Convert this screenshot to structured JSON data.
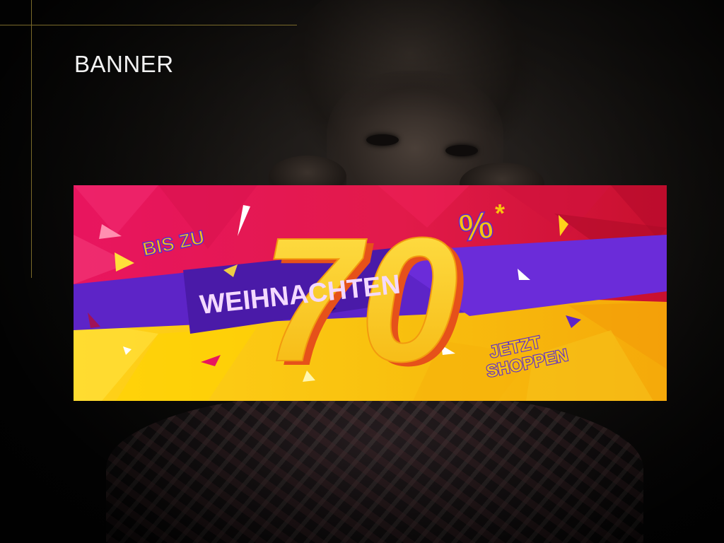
{
  "page": {
    "section_title": "BANNER"
  },
  "banner": {
    "prefix": "BIS ZU",
    "discount_number": "70",
    "percent_sign": "%",
    "asterisk": "*",
    "headline": "WEIHNACHTEN",
    "cta_line1": "JETZT",
    "cta_line2": "SHOPPEN"
  },
  "colors": {
    "background": "#0a0a0a",
    "guide_line": "#7a6a2a",
    "banner_magenta": "#e8155f",
    "banner_yellow": "#f9c20f",
    "banner_purple": "#6b2cd9",
    "headline_text": "#f4d9ff",
    "cta_text": "#5a2bd0"
  }
}
